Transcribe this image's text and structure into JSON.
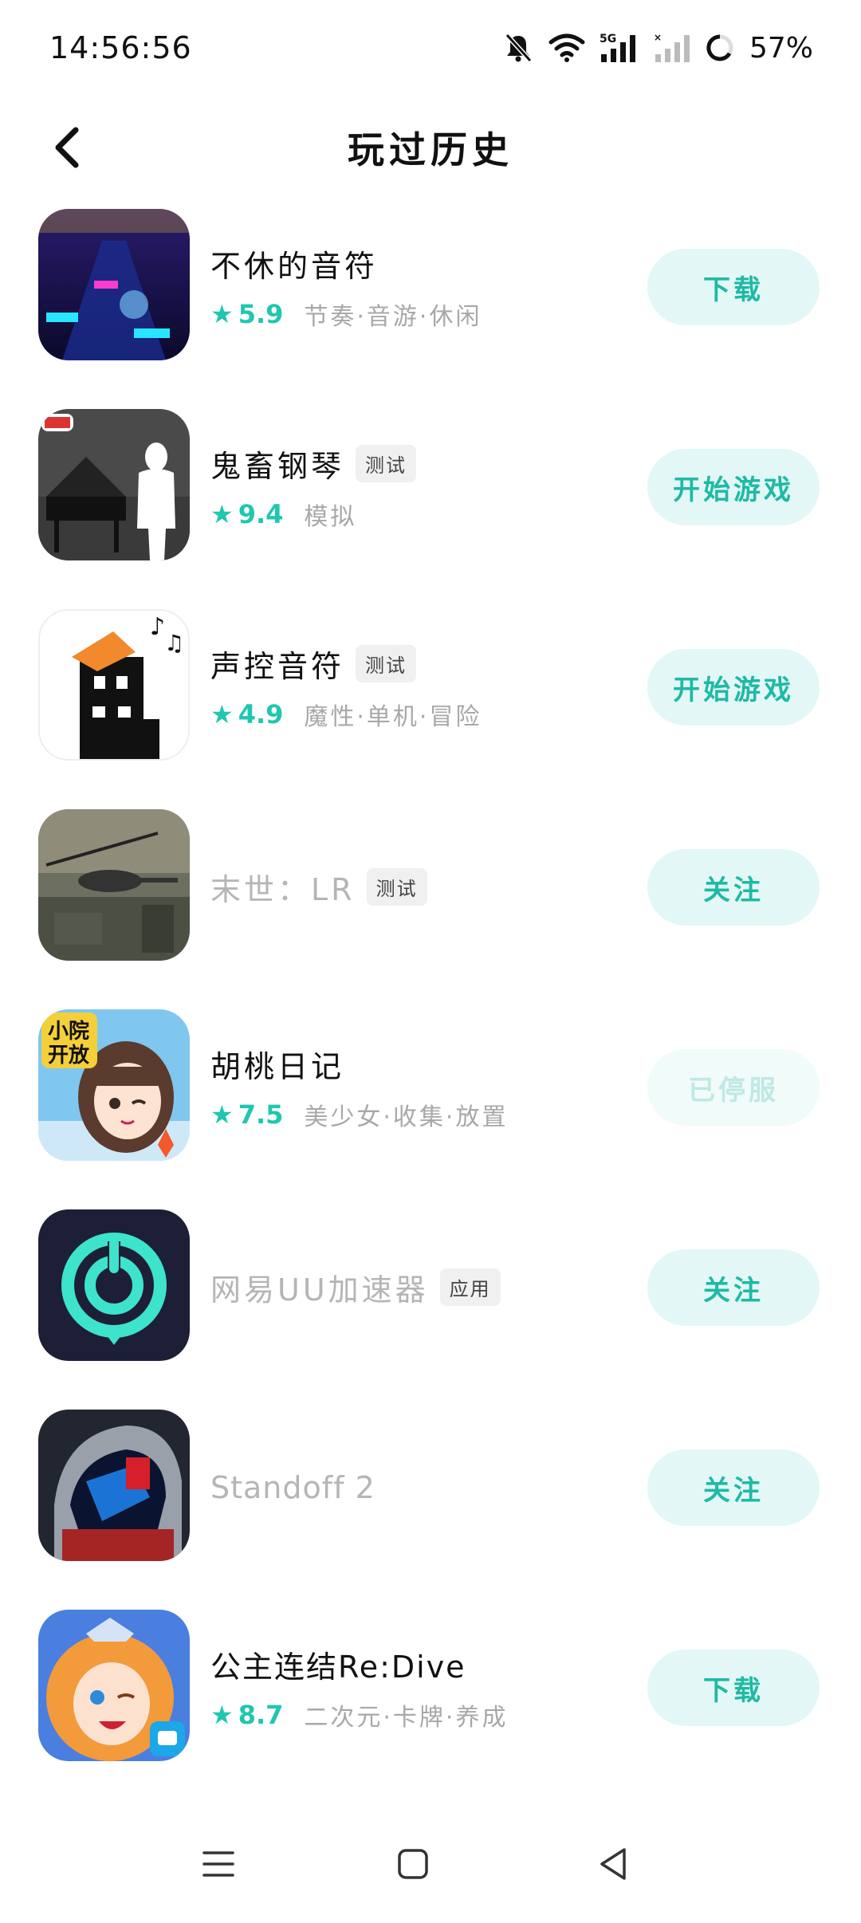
{
  "status_bar": {
    "time": "14:56:56",
    "battery_percent": "57%",
    "network": "5G"
  },
  "header": {
    "title": "玩过历史"
  },
  "games": [
    {
      "name": "不休的音符",
      "rating": "5.9",
      "categories": "节奏·音游·休闲",
      "tag": "",
      "action": "下载",
      "dim": false,
      "disabled": false,
      "icon": "rhythm-game-icon"
    },
    {
      "name": "鬼畜钢琴",
      "rating": "9.4",
      "categories": "模拟",
      "tag": "测试",
      "action": "开始游戏",
      "dim": false,
      "disabled": false,
      "icon": "piano-game-icon"
    },
    {
      "name": "声控音符",
      "rating": "4.9",
      "categories": "魔性·单机·冒险",
      "tag": "测试",
      "action": "开始游戏",
      "dim": false,
      "disabled": false,
      "icon": "voice-note-game-icon"
    },
    {
      "name": "末世：LR",
      "rating": "",
      "categories": "",
      "tag": "测试",
      "action": "关注",
      "dim": true,
      "disabled": false,
      "icon": "helicopter-game-icon"
    },
    {
      "name": "胡桃日记",
      "rating": "7.5",
      "categories": "美少女·收集·放置",
      "tag": "",
      "action": "已停服",
      "dim": false,
      "disabled": true,
      "icon": "anime-girl-game-icon"
    },
    {
      "name": "网易UU加速器",
      "rating": "",
      "categories": "",
      "tag": "应用",
      "action": "关注",
      "dim": true,
      "disabled": false,
      "icon": "uu-accelerator-icon"
    },
    {
      "name": "Standoff 2",
      "rating": "",
      "categories": "",
      "tag": "",
      "action": "关注",
      "dim": true,
      "disabled": false,
      "icon": "helmet-game-icon"
    },
    {
      "name": "公主连结Re:Dive",
      "rating": "8.7",
      "categories": "二次元·卡牌·养成",
      "tag": "",
      "action": "下载",
      "dim": false,
      "disabled": false,
      "icon": "princess-game-icon"
    }
  ],
  "colors": {
    "accent": "#1fc7b0",
    "button_bg": "#e3f8f6",
    "muted": "#a8a8a8"
  }
}
